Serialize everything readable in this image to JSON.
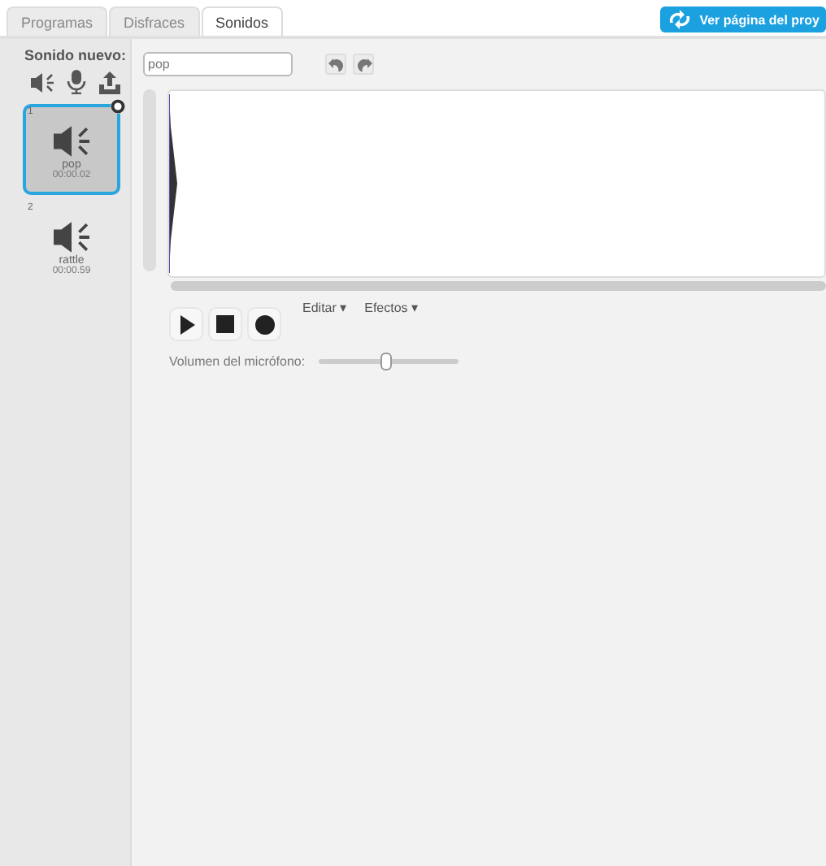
{
  "tabs": [
    {
      "label": "Programas",
      "selected": false
    },
    {
      "label": "Disfraces",
      "selected": false
    },
    {
      "label": "Sonidos",
      "selected": true
    }
  ],
  "project_button": {
    "label": "Ver página del proy"
  },
  "sidebar": {
    "title": "Sonido nuevo:",
    "sounds": [
      {
        "index": "1",
        "name": "pop",
        "duration": "00:00.02",
        "selected": true
      },
      {
        "index": "2",
        "name": "rattle",
        "duration": "00:00.59",
        "selected": false
      }
    ]
  },
  "editor": {
    "name_field": {
      "value": "pop"
    },
    "menus": [
      "Editar ▾",
      "Efectos ▾"
    ],
    "mic_volume": {
      "label": "Volumen del micrófono:",
      "level": 0.48
    }
  }
}
